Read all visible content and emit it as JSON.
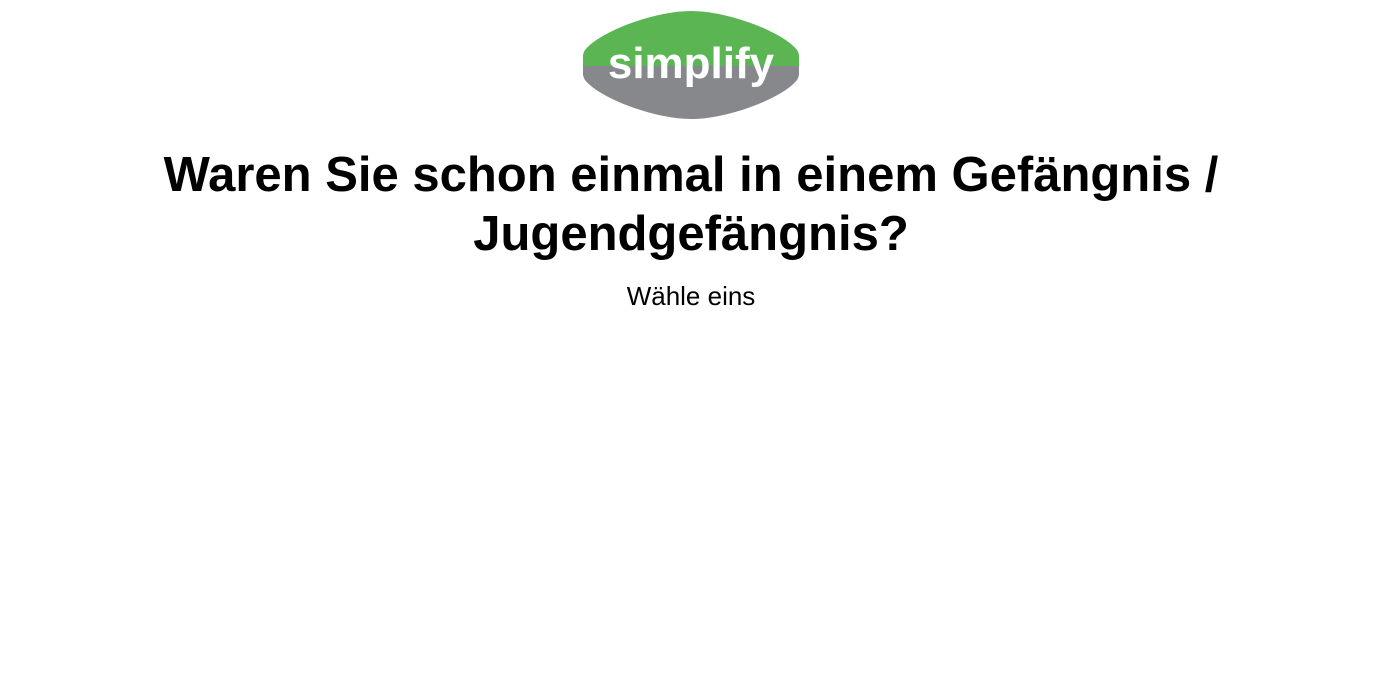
{
  "brand": {
    "logo_text": "simplify",
    "top_color": "#5ab552",
    "bottom_color": "#87888b"
  },
  "question": {
    "title": "Waren Sie schon einmal in einem Gefängnis / Jugendgefängnis?",
    "subtitle": "Wähle eins"
  }
}
